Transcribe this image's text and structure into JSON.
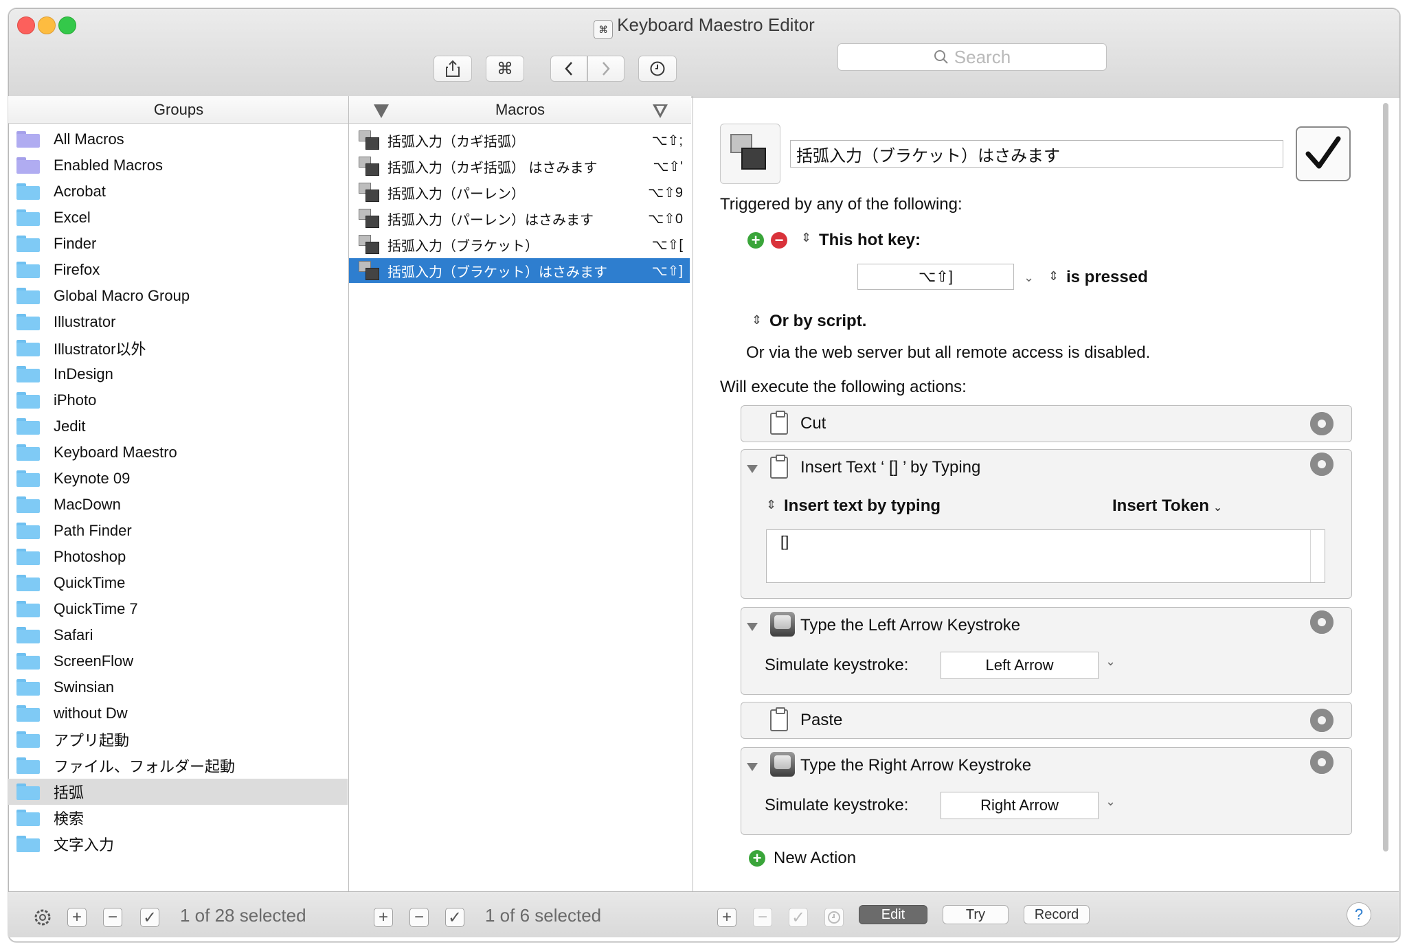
{
  "window": {
    "title": "Keyboard Maestro Editor"
  },
  "toolbar": {
    "share_icon": "share-icon",
    "cmd_label": "⌘",
    "back_icon": "chevron-left-icon",
    "forward_icon": "chevron-right-icon",
    "history_icon": "clock-icon",
    "search_placeholder": "Search"
  },
  "groups": {
    "header": "Groups",
    "items": [
      {
        "label": "All Macros",
        "type": "smart"
      },
      {
        "label": "Enabled Macros",
        "type": "smart"
      },
      {
        "label": "Acrobat",
        "type": "folder"
      },
      {
        "label": "Excel",
        "type": "folder"
      },
      {
        "label": "Finder",
        "type": "folder"
      },
      {
        "label": "Firefox",
        "type": "folder"
      },
      {
        "label": "Global Macro Group",
        "type": "folder"
      },
      {
        "label": "Illustrator",
        "type": "folder"
      },
      {
        "label": "Illustrator以外",
        "type": "folder"
      },
      {
        "label": "InDesign",
        "type": "folder"
      },
      {
        "label": "iPhoto",
        "type": "folder"
      },
      {
        "label": "Jedit",
        "type": "folder"
      },
      {
        "label": "Keyboard Maestro",
        "type": "folder"
      },
      {
        "label": "Keynote 09",
        "type": "folder"
      },
      {
        "label": "MacDown",
        "type": "folder"
      },
      {
        "label": "Path Finder",
        "type": "folder"
      },
      {
        "label": "Photoshop",
        "type": "folder"
      },
      {
        "label": "QuickTime",
        "type": "folder"
      },
      {
        "label": "QuickTime 7",
        "type": "folder"
      },
      {
        "label": "Safari",
        "type": "folder"
      },
      {
        "label": "ScreenFlow",
        "type": "folder"
      },
      {
        "label": "Swinsian",
        "type": "folder"
      },
      {
        "label": "without Dw",
        "type": "folder"
      },
      {
        "label": "アプリ起動",
        "type": "folder"
      },
      {
        "label": "ファイル、フォルダー起動",
        "type": "folder"
      },
      {
        "label": "括弧",
        "type": "folder",
        "selected": true
      },
      {
        "label": "検索",
        "type": "folder"
      },
      {
        "label": "文字入力",
        "type": "folder"
      }
    ],
    "status": "1 of 28 selected"
  },
  "macros": {
    "header": "Macros",
    "items": [
      {
        "label": "括弧入力（カギ括弧）",
        "key": "⌥⇧;"
      },
      {
        "label": "括弧入力（カギ括弧） はさみます",
        "key": "⌥⇧'"
      },
      {
        "label": "括弧入力（パーレン）",
        "key": "⌥⇧9"
      },
      {
        "label": "括弧入力（パーレン）はさみます",
        "key": "⌥⇧0"
      },
      {
        "label": "括弧入力（ブラケット）",
        "key": "⌥⇧["
      },
      {
        "label": "括弧入力（ブラケット）はさみます",
        "key": "⌥⇧]",
        "selected": true
      }
    ],
    "status": "1 of 6 selected"
  },
  "editor": {
    "macro_name": "括弧入力（ブラケット）はさみます",
    "enabled_check": "✓",
    "triggered_label": "Triggered by any of the following:",
    "hotkey_label": "This hot key:",
    "hotkey_value": "⌥⇧]",
    "is_pressed": "is pressed",
    "or_by_script": "Or by script.",
    "web_server_note": "Or via the web server but all remote access is disabled.",
    "execute_label": "Will execute the following actions:",
    "actions": {
      "cut": "Cut",
      "insert_title": "Insert Text ‘ [] ’ by Typing",
      "insert_mode": "Insert text by typing",
      "insert_token": "Insert Token",
      "insert_value": "[]",
      "left_title": "Type the Left Arrow Keystroke",
      "simulate_label": "Simulate keystroke:",
      "left_value": "Left Arrow",
      "paste": "Paste",
      "right_title": "Type the Right Arrow Keystroke",
      "simulate_label2": "Simulate keystroke:",
      "right_value": "Right Arrow"
    },
    "new_action": "New Action"
  },
  "bottom": {
    "edit": "Edit",
    "try": "Try",
    "record": "Record",
    "help": "?"
  },
  "colors": {
    "selection_blue": "#2e7ecf",
    "folder_blue": "#7fcaf5",
    "smart_folder": "#b0acf1",
    "add_green": "#3aa53a",
    "remove_red": "#d9323a"
  }
}
